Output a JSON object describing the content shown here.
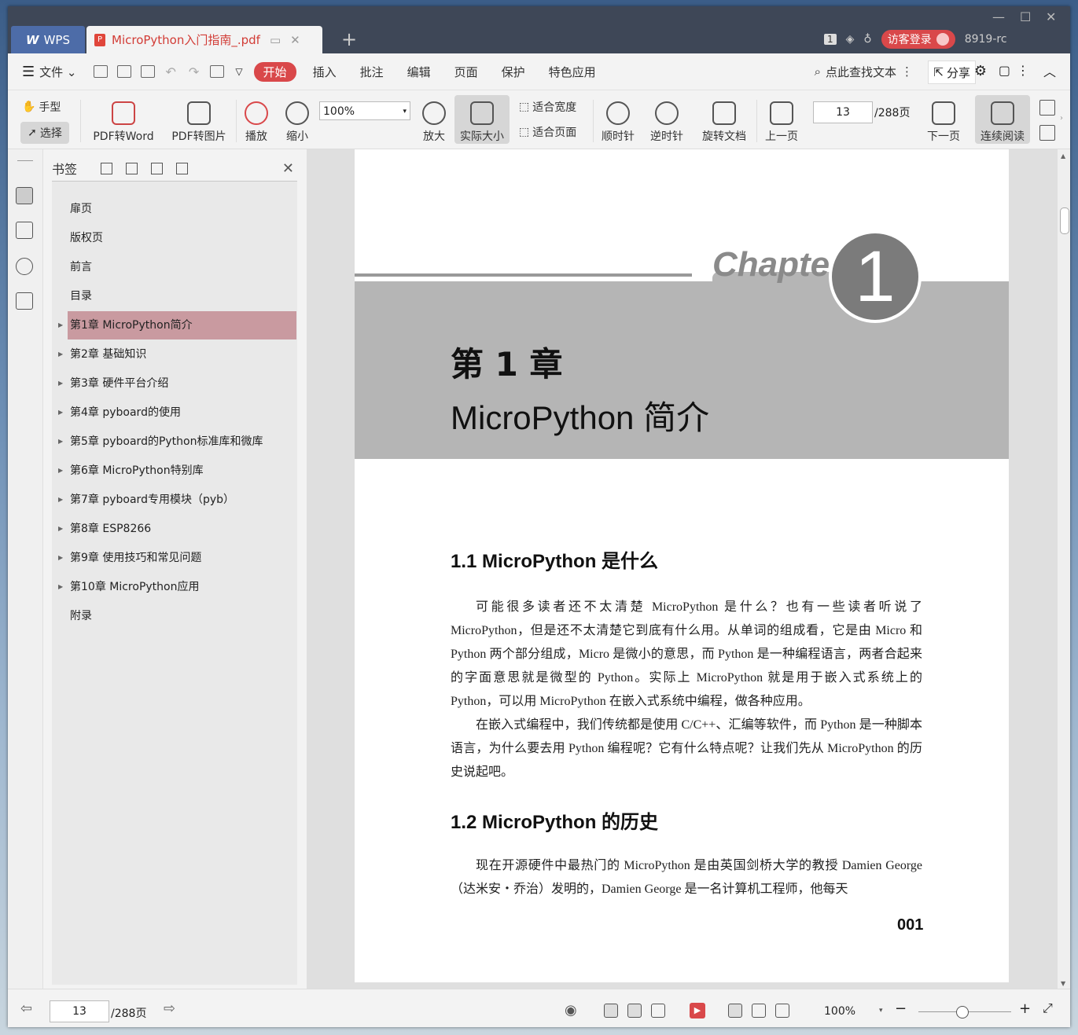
{
  "titlebar": {
    "app_name": "WPS",
    "doc_tab_title": "MicroPython入门指南_.pdf",
    "page_badge": "1",
    "login_label": "访客登录",
    "version": "8919-rc"
  },
  "menubar": {
    "file_label": "文件",
    "tabs": [
      "开始",
      "插入",
      "批注",
      "编辑",
      "页面",
      "保护",
      "特色应用"
    ],
    "active_tab": "开始",
    "search_label": "点此查找文本",
    "share_label": "分享"
  },
  "toolbar": {
    "hand_label": "手型",
    "select_label": "选择",
    "pdf_word_label": "PDF转Word",
    "pdf_img_label": "PDF转图片",
    "play_label": "播放",
    "zoom_out_label": "缩小",
    "zoom_value": "100%",
    "zoom_in_label": "放大",
    "actual_size_label": "实际大小",
    "fit_width_label": "适合宽度",
    "fit_page_label": "适合页面",
    "cw_label": "顺时针",
    "ccw_label": "逆时针",
    "rotate_label": "旋转文档",
    "prev_label": "上一页",
    "page_value": "13",
    "page_total": "/288页",
    "next_label": "下一页",
    "continuous_label": "连续阅读"
  },
  "bookmarks": {
    "title": "书签",
    "items": [
      {
        "label": "扉页",
        "expandable": false
      },
      {
        "label": "版权页",
        "expandable": false
      },
      {
        "label": "前言",
        "expandable": false
      },
      {
        "label": "目录",
        "expandable": false
      },
      {
        "label": "第1章  MicroPython简介",
        "expandable": true,
        "selected": true
      },
      {
        "label": "第2章  基础知识",
        "expandable": true
      },
      {
        "label": "第3章  硬件平台介绍",
        "expandable": true
      },
      {
        "label": "第4章  pyboard的使用",
        "expandable": true
      },
      {
        "label": "第5章  pyboard的Python标准库和微库",
        "expandable": true
      },
      {
        "label": "第6章  MicroPython特别库",
        "expandable": true
      },
      {
        "label": "第7章  pyboard专用模块（pyb）",
        "expandable": true
      },
      {
        "label": "第8章  ESP8266",
        "expandable": true
      },
      {
        "label": "第9章  使用技巧和常见问题",
        "expandable": true
      },
      {
        "label": "第10章  MicroPython应用",
        "expandable": true
      },
      {
        "label": "附录",
        "expandable": false
      }
    ]
  },
  "page": {
    "chapter_word": "Chapter",
    "chapter_number": "1",
    "title_cn": "第 1 章",
    "title_en": "MicroPython 简介",
    "s1_heading": "1.1   MicroPython 是什么",
    "s1_p1": "可能很多读者还不太清楚 MicroPython 是什么？也有一些读者听说了 MicroPython，但是还不太清楚它到底有什么用。从单词的组成看，它是由 Micro 和 Python 两个部分组成，Micro 是微小的意思，而 Python 是一种编程语言，两者合起来的字面意思就是微型的 Python。实际上 MicroPython 就是用于嵌入式系统上的 Python，可以用 MicroPython 在嵌入式系统中编程，做各种应用。",
    "s1_p2": "在嵌入式编程中，我们传统都是使用 C/C++、汇编等软件，而 Python 是一种脚本语言，为什么要去用 Python 编程呢？它有什么特点呢？让我们先从 MicroPython 的历史说起吧。",
    "s2_heading": "1.2   MicroPython 的历史",
    "s2_p1": "现在开源硬件中最热门的 MicroPython 是由英国剑桥大学的教授 Damien George（达米安・乔治）发明的，Damien George 是一名计算机工程师，他每天",
    "page_number": "001"
  },
  "status": {
    "page_value": "13",
    "page_total": "/288页",
    "zoom_value": "100%"
  }
}
